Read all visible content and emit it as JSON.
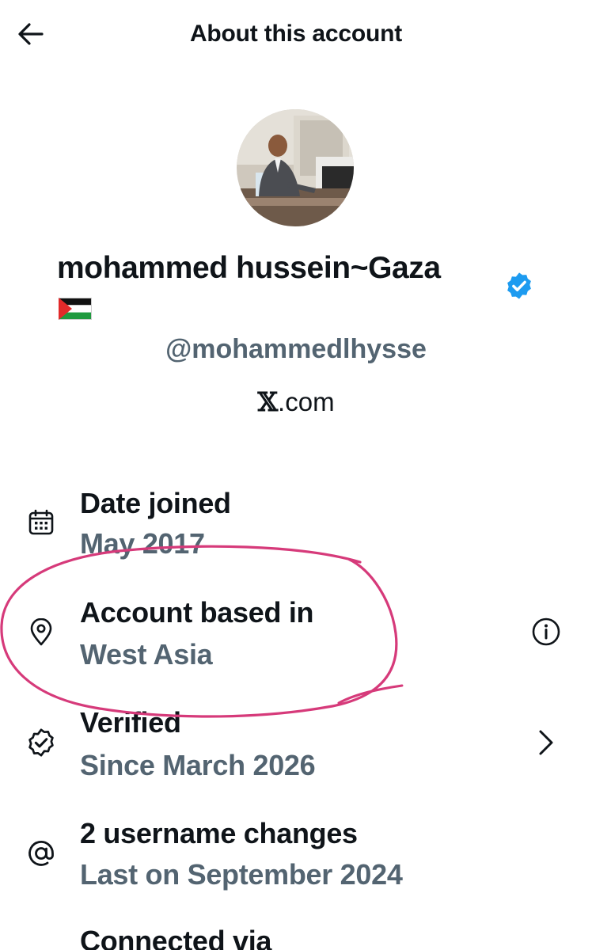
{
  "header": {
    "title": "About this account"
  },
  "profile": {
    "display_name": "mohammed hussein~Gaza",
    "handle": "@mohammedlhysse",
    "domain_x": "𝕏",
    "domain_suffix": ".com"
  },
  "rows": [
    {
      "title": "Date joined",
      "value": "May 2017",
      "icon": "calendar-icon"
    },
    {
      "title": "Account based in",
      "value": "West Asia",
      "icon": "location-pin-icon",
      "action_icon": "info-icon"
    },
    {
      "title": "Verified",
      "value": "Since March 2026",
      "icon": "verified-check-icon",
      "action_icon": "chevron-right-icon"
    },
    {
      "title": "2 username changes",
      "value": "Last on September 2024",
      "icon": "at-sign-icon"
    },
    {
      "title": "Connected via",
      "value": ""
    }
  ],
  "colors": {
    "text_primary": "#0f1419",
    "text_secondary": "#536471",
    "verified_blue": "#1d9bf0",
    "annotation_pink": "#d63a7a"
  }
}
